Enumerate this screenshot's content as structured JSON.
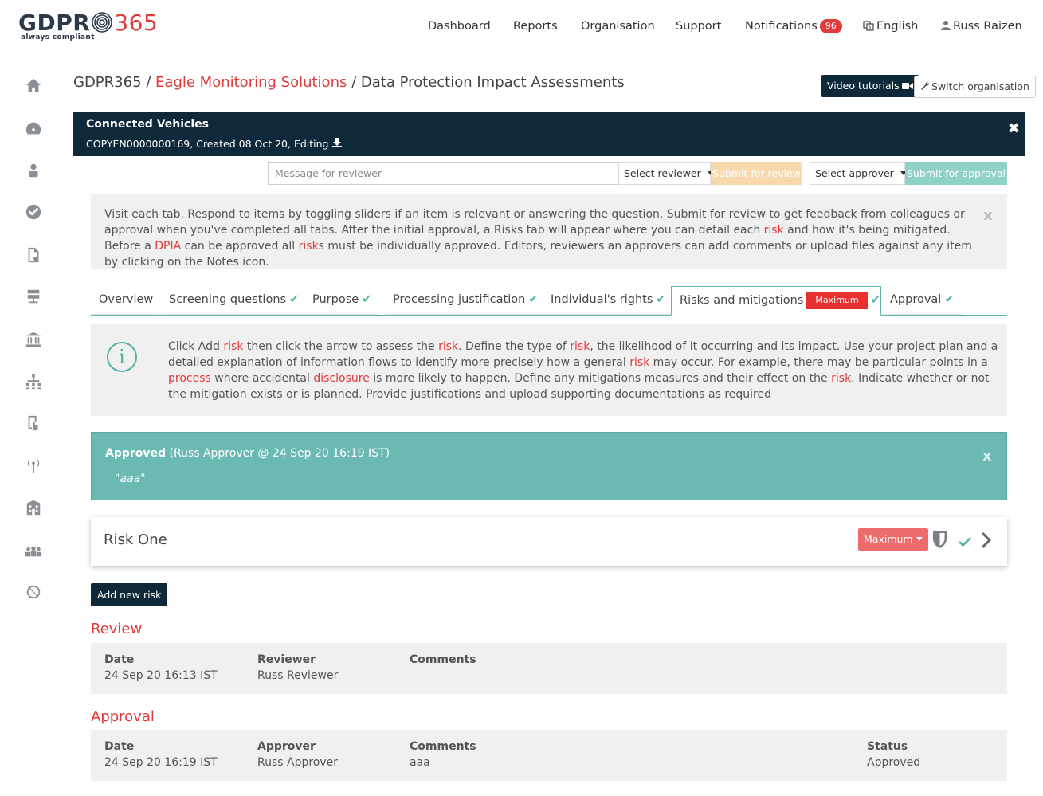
{
  "header": {
    "logo_main": "GDPR",
    "logo_accent": "365",
    "logo_tagline": "always compliant",
    "nav": {
      "dashboard": "Dashboard",
      "reports": "Reports",
      "organisation": "Organisation",
      "support": "Support",
      "notifications": "Notifications",
      "notifications_count": "96",
      "language": "English",
      "user": "Russ Raizen"
    }
  },
  "sidebar": {
    "items": [
      "home-icon",
      "dashboard-icon",
      "person-icon",
      "check-circle-icon",
      "document-settings-icon",
      "database-icon",
      "bank-icon",
      "org-chart-icon",
      "mobile-touch-icon",
      "broadcast-icon",
      "building-icon",
      "users-icon",
      "no-transfer-icon"
    ]
  },
  "breadcrumb": {
    "root": "GDPR365",
    "sep1": " / ",
    "org": "Eagle Monitoring Solutions",
    "sep2": " / ",
    "page": "Data Protection Impact Assessments"
  },
  "actions": {
    "video": "Video tutorials",
    "switch": "Switch organisation"
  },
  "document": {
    "title": "Connected Vehicles",
    "meta": "COPYEN0000000169, Created 08 Oct 20, Editing"
  },
  "review_bar": {
    "message_placeholder": "Message for reviewer",
    "select_reviewer": "Select reviewer",
    "submit_review": "Submit for review",
    "select_approver": "Select approver",
    "submit_approval": "Submit for approval"
  },
  "info": {
    "t1": "Visit each tab. Respond to items by toggling sliders if an item is relevant or answering the question. Submit for review to get feedback from colleagues or approval when you've completed all tabs. After the initial approval, a Risks tab will appear where you can detail each ",
    "k1": "risk",
    "t2": " and how it's being mitigated. Before a ",
    "k2": "DPIA",
    "t3": " can be approved all ",
    "k3": "risk",
    "t4": "s must be individually approved. Editors, reviewers an approvers can add comments or upload files against any item by clicking on the Notes icon."
  },
  "tabs": {
    "overview": "Overview",
    "screening": "Screening questions",
    "purpose": "Purpose",
    "processing": "Processing justification",
    "rights": "Individual's rights",
    "risks": "Risks and mitigations",
    "risks_badge": "Maximum",
    "approval": "Approval"
  },
  "guide": {
    "icon_glyph": "i",
    "t1": "Click Add ",
    "k1": "risk",
    "t2": " then click the arrow to assess the ",
    "k2": "risk",
    "t3": ". Define the type of ",
    "k3": "risk",
    "t4": ", the likelihood of it occurring and its impact. Use your project plan and a detailed explanation of information flows to identify more precisely how a general ",
    "k4": "risk",
    "t5": " may occur. For example, there may be particular points in a ",
    "k5": "process",
    "t6": " where accidental ",
    "k6": "disclosure",
    "t7": " is more likely to happen. Define any mitigations measures and their effect on the ",
    "k7": "risk",
    "t8": ". Indicate whether or not the mitigation exists or is planned. Provide justifications and upload supporting documentations as required"
  },
  "approved": {
    "label": "Approved",
    "detail": " (Russ Approver @ 24 Sep 20 16:19 IST)",
    "quote": "\"aaa\""
  },
  "risk": {
    "title": "Risk One",
    "level": "Maximum"
  },
  "add_risk": "Add new risk",
  "review": {
    "title": "Review",
    "headers": {
      "date": "Date",
      "reviewer": "Reviewer",
      "comments": "Comments"
    },
    "row": {
      "date": "24 Sep 20 16:13 IST",
      "reviewer": "Russ Reviewer",
      "comments": ""
    }
  },
  "approval": {
    "title": "Approval",
    "headers": {
      "date": "Date",
      "approver": "Approver",
      "comments": "Comments",
      "status": "Status"
    },
    "row": {
      "date": "24 Sep 20 16:19 IST",
      "approver": "Russ Approver",
      "comments": "aaa",
      "status": "Approved"
    }
  },
  "colors": {
    "brand_dark": "#0e2a3a",
    "accent_red": "#e03a3a",
    "teal": "#6bbab1",
    "review_orange": "#f7d9ad"
  }
}
